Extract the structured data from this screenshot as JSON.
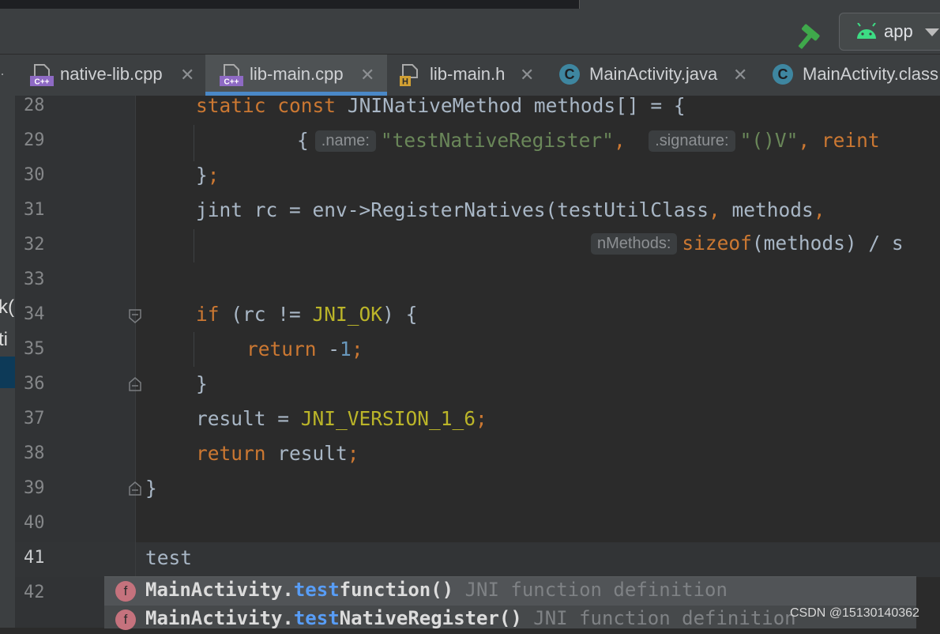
{
  "toolbar": {
    "run_config": "app",
    "icons": [
      "hammer-icon",
      "android-icon",
      "chevron-down-icon"
    ]
  },
  "tabs": [
    {
      "label": "native-lib.cpp",
      "icon": "cpp-file-icon",
      "active": false
    },
    {
      "label": "lib-main.cpp",
      "icon": "cpp-file-icon",
      "active": true
    },
    {
      "label": "lib-main.h",
      "icon": "h-file-icon",
      "active": false
    },
    {
      "label": "MainActivity.java",
      "icon": "class-icon",
      "active": false
    },
    {
      "label": "MainActivity.class",
      "icon": "class-icon",
      "active": false
    }
  ],
  "file_icon_badges": {
    "cpp": "C++",
    "h": "H",
    "class": "C"
  },
  "left_panel_fragments": [
    "k(",
    "ti"
  ],
  "line_numbers": [
    "28",
    "29",
    "30",
    "31",
    "32",
    "33",
    "34",
    "35",
    "36",
    "37",
    "38",
    "39",
    "40",
    "41",
    "42"
  ],
  "current_line": "41",
  "code": {
    "l28": [
      "static",
      "const",
      "JNINativeMethod methods[] = {"
    ],
    "l29": [
      "{",
      ".name:",
      "\"testNativeRegister\"",
      ",",
      ".signature:",
      "\"()V\"",
      ",",
      "reint"
    ],
    "l30": [
      "}",
      ";"
    ],
    "l31": [
      "jint rc = env->RegisterNatives(testUtilClass",
      ",",
      "methods",
      ","
    ],
    "l32": [
      "nMethods:",
      "sizeof",
      "(methods) / s"
    ],
    "l34": [
      "if",
      "(rc != ",
      "JNI_OK",
      ") {"
    ],
    "l35": [
      "return",
      "-",
      "1",
      ";"
    ],
    "l36": [
      "}"
    ],
    "l37": [
      "result = ",
      "JNI_VERSION_1_6",
      ";"
    ],
    "l38": [
      "return",
      "result",
      ";"
    ],
    "l39": [
      "}"
    ],
    "l41": [
      "test"
    ]
  },
  "completion": [
    {
      "icon": "f",
      "prefix": "MainActivity.",
      "match": "test",
      "rest": "function()",
      "desc": "JNI function definition",
      "selected": true
    },
    {
      "icon": "f",
      "prefix": "MainActivity.",
      "match": "test",
      "rest": "NativeRegister()",
      "desc": "JNI function definition",
      "selected": false
    }
  ],
  "watermark": "CSDN @15130140362",
  "colors": {
    "keyword": "#cc7832",
    "macro": "#bbb529",
    "string": "#6a8759",
    "number": "#6897bb",
    "identifier": "#a9b7c6",
    "match": "#589df6",
    "active_tab_bar": "#4a88c7"
  }
}
